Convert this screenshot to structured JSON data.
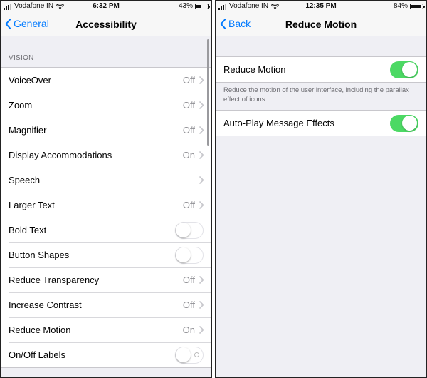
{
  "left": {
    "status": {
      "carrier": "Vodafone IN",
      "time": "6:32 PM",
      "battery": "43%",
      "battery_level": 0.43
    },
    "nav": {
      "back_label": "General",
      "title": "Accessibility"
    },
    "section_header": "VISION",
    "items": [
      {
        "label": "VoiceOver",
        "value": "Off",
        "type": "chevron"
      },
      {
        "label": "Zoom",
        "value": "Off",
        "type": "chevron"
      },
      {
        "label": "Magnifier",
        "value": "Off",
        "type": "chevron"
      },
      {
        "label": "Display Accommodations",
        "value": "On",
        "type": "chevron"
      },
      {
        "label": "Speech",
        "value": "",
        "type": "chevron"
      },
      {
        "label": "Larger Text",
        "value": "Off",
        "type": "chevron"
      },
      {
        "label": "Bold Text",
        "value": "",
        "type": "toggle",
        "on": false
      },
      {
        "label": "Button Shapes",
        "value": "",
        "type": "toggle",
        "on": false
      },
      {
        "label": "Reduce Transparency",
        "value": "Off",
        "type": "chevron"
      },
      {
        "label": "Increase Contrast",
        "value": "Off",
        "type": "chevron"
      },
      {
        "label": "Reduce Motion",
        "value": "On",
        "type": "chevron"
      },
      {
        "label": "On/Off Labels",
        "value": "",
        "type": "toggle",
        "on": false
      }
    ]
  },
  "right": {
    "status": {
      "carrier": "Vodafone IN",
      "time": "12:35 PM",
      "battery": "84%",
      "battery_level": 0.84
    },
    "nav": {
      "back_label": "Back",
      "title": "Reduce Motion"
    },
    "reduce_motion": {
      "label": "Reduce Motion",
      "on": true
    },
    "reduce_motion_footer": "Reduce the motion of the user interface, including the parallax effect of icons.",
    "auto_play": {
      "label": "Auto-Play Message Effects",
      "on": true
    }
  },
  "colors": {
    "accent": "#007aff",
    "toggle_on": "#4cd964",
    "group_bg": "#efeff4"
  },
  "icons": {
    "back": "chevron-left-icon",
    "disclosure": "chevron-right-icon",
    "wifi": "wifi-icon"
  }
}
